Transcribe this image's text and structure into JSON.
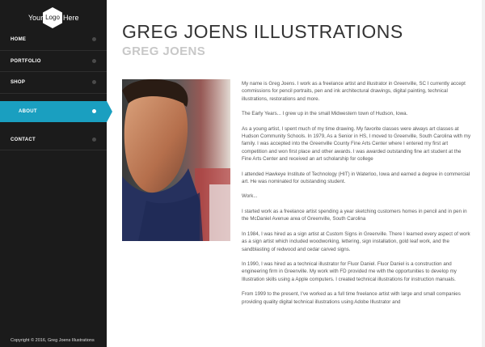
{
  "logo": {
    "left": "Your",
    "center": "Logo",
    "right": "Here"
  },
  "nav": {
    "items": [
      {
        "label": "HOME",
        "active": false
      },
      {
        "label": "PORTFOLIO",
        "active": false
      },
      {
        "label": "SHOP",
        "active": false
      },
      {
        "label": "ABOUT",
        "active": true
      },
      {
        "label": "CONTACT",
        "active": false
      }
    ]
  },
  "footer": {
    "copyright": "Copyright © 2016, Greg Joens Illustrations"
  },
  "header": {
    "title": "GREG JOENS ILLUSTRATIONS",
    "subtitle": "GREG JOENS"
  },
  "colors": {
    "sidebar": "#1b1b1b",
    "accent": "#1a9fc0",
    "title": "#333333",
    "subtitle": "#c8c8c8",
    "text": "#555555"
  },
  "content": {
    "paragraphs": [
      "My name is Greg Joens. I work as a freelance artist and illustrator in Greenville, SC I currently accept commissions for pencil portraits, pen and ink architectural drawings, digital painting, technical illustrations, restorations and more.",
      "The Early Years... I grew up in the small Midwestern town of Hudson, Iowa.",
      "As a young artist, I spent much of my time drawing. My favorite classes were always art classes at Hudson Community Schools. In 1979, As a Senior in HS, I moved to Greenville, South Carolina with my family. I was accepted into the Greenville County Fine Arts Center where I entered my first art competition and won first place and other awards. I was awarded outstanding fine art student at the Fine Arts Center and received an art scholarship for college",
      "I attended Hawkeye Institute of Technology (HIT) in Waterloo, Iowa and earned a degree in commercial art. He was nominated for outstanding student.",
      "Work...",
      "I started work as a freelance artist spending a year sketching customers homes in pencil and in pen in the McDaniel Avenue area of Greenville, South Carolina",
      "In 1984, I was hired as a sign artist at Custom Signs in Greenville. There I learned every aspect of work as a sign artist which included woodworking, lettering, sign installation, gold leaf work, and the sandblasting of redwood and cedar carved signs.",
      "In 1990, I was hired as a technical illustrator for Fluor Daniel. Fluor Daniel is a construction and engineering firm in Greenville. My work with FD provided me with the opportunities to develop my Illustration skills using a Apple computers. I created technical illustrations for instruction manuals.",
      "From 1999 to the present, I've worked as a full time freelance artist with large and small companies providing quality digital technical illustrations using Adobe Illustrator and"
    ]
  }
}
